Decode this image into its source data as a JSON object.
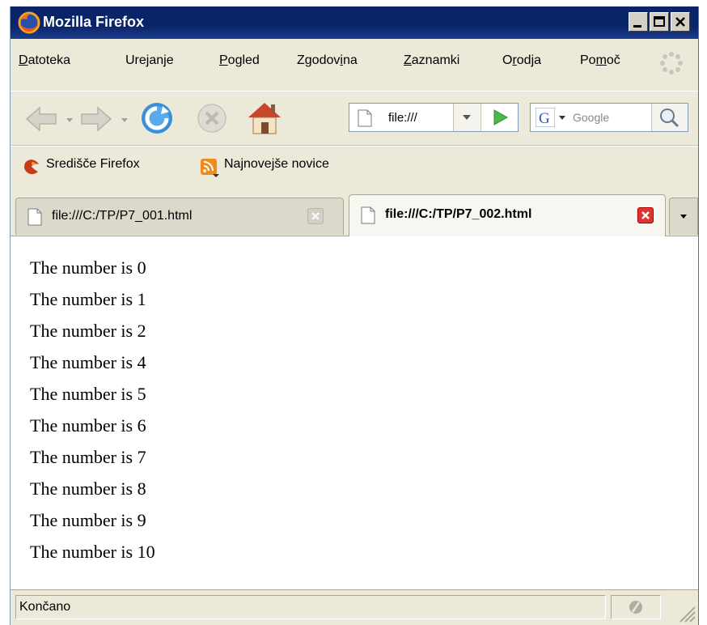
{
  "window": {
    "title": "Mozilla Firefox",
    "title_bar_color": "#0a246a"
  },
  "menu": {
    "items": [
      {
        "label": "Datoteka",
        "underline": "D"
      },
      {
        "label": "Urejanje",
        "underline": "j"
      },
      {
        "label": "Pogled",
        "underline": "P"
      },
      {
        "label": "Zgodovina",
        "underline": "i"
      },
      {
        "label": "Zaznamki",
        "underline": "Z"
      },
      {
        "label": "Orodja",
        "underline": "r"
      },
      {
        "label": "Pomoč",
        "underline": "m"
      }
    ]
  },
  "navbar": {
    "url": "file:///",
    "search_placeholder": "Google",
    "icons": [
      "back-icon",
      "forward-icon",
      "reload-icon",
      "stop-icon",
      "home-icon",
      "go-icon",
      "google-icon",
      "search-icon"
    ]
  },
  "bookmarks": {
    "items": [
      {
        "label": "Središče Firefox",
        "icon": "firefox-help-icon"
      },
      {
        "label": "Najnovejše novice",
        "icon": "rss-icon"
      }
    ]
  },
  "tabs": [
    {
      "label": "file:///C:/TP/P7_001.html",
      "active": false
    },
    {
      "label": "file:///C:/TP/P7_002.html",
      "active": true
    }
  ],
  "content": {
    "lines": [
      "The number is 0",
      "The number is 1",
      "The number is 2",
      "The number is 4",
      "The number is 5",
      "The number is 6",
      "The number is 7",
      "The number is 8",
      "The number is 9",
      "The number is 10"
    ]
  },
  "status": {
    "text": "Končano"
  }
}
